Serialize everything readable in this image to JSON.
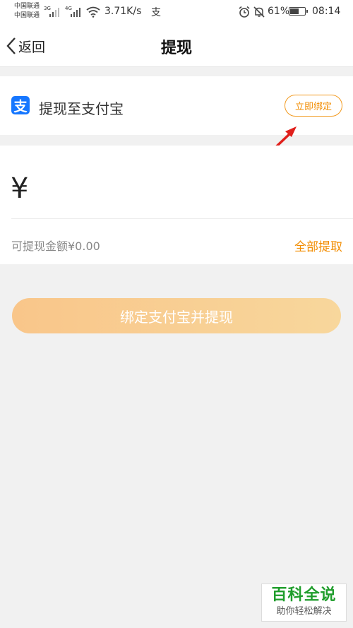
{
  "status_bar": {
    "carrier_1": "中国联通",
    "carrier_2": "中国联通",
    "net_1": "3G",
    "net_2": "4G",
    "speed": "3.71K/s",
    "alipay_glyph": "支",
    "battery_pct": "61%",
    "battery_level": 0.61,
    "time": "08:14"
  },
  "nav": {
    "back_label": "返回",
    "title": "提现"
  },
  "bind_card": {
    "logo_glyph": "支",
    "title": "提现至支付宝",
    "bind_button": "立即绑定"
  },
  "amount": {
    "currency_symbol": "¥",
    "available_text": "可提现金额¥0.00",
    "withdraw_all": "全部提取"
  },
  "submit_button": "绑定支付宝并提现",
  "watermark": {
    "title": "百科全说",
    "subtitle": "助你轻松解决"
  },
  "colors": {
    "accent": "#f28c00",
    "alipay_blue": "#1677ff",
    "button_gradient_start": "#f9c68a",
    "button_gradient_end": "#f8d79c",
    "annotation_arrow": "#e0201c",
    "watermark_green": "#1f9d2b"
  },
  "icons": [
    "chevron-left-icon",
    "alipay-icon",
    "alarm-icon",
    "mute-bell-icon",
    "wifi-icon",
    "signal-icon",
    "battery-icon",
    "red-arrow-icon"
  ]
}
